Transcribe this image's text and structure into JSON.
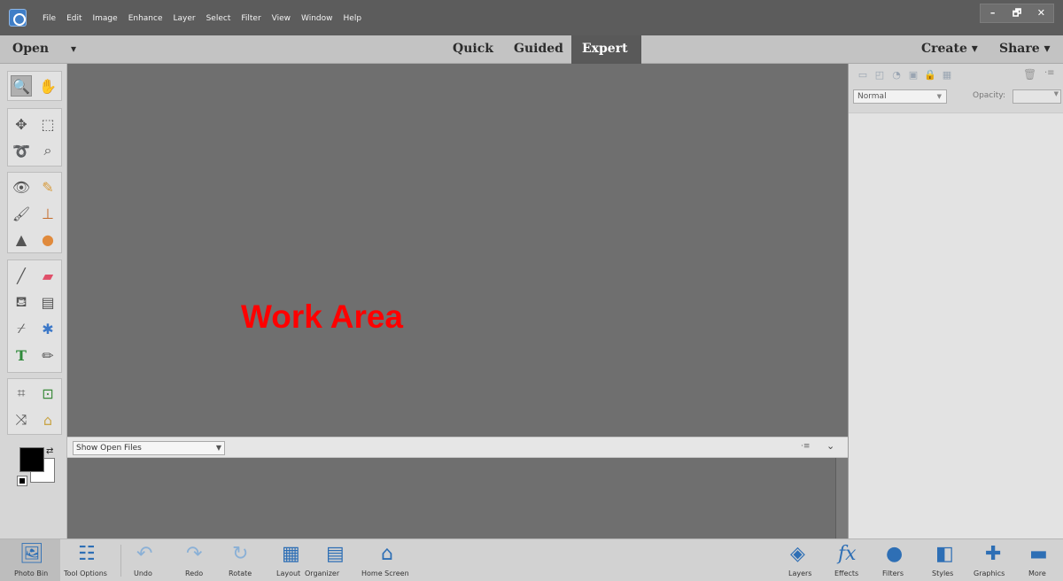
{
  "menu": [
    "File",
    "Edit",
    "Image",
    "Enhance",
    "Layer",
    "Select",
    "Filter",
    "View",
    "Window",
    "Help"
  ],
  "window_controls": {
    "minimize": "–",
    "restore": "🗗",
    "close": "✕"
  },
  "modebar": {
    "open": "Open",
    "caret": "▾",
    "tabs": [
      "Quick",
      "Guided",
      "Expert"
    ],
    "active_tab": "Expert",
    "create": "Create",
    "share": "Share"
  },
  "work_area": {
    "label": "Work Area",
    "label_color": "#ff0000"
  },
  "photo_bin": {
    "select_value": "Show Open Files"
  },
  "layers_panel": {
    "blend_mode": "Normal",
    "opacity_label": "Opacity:"
  },
  "colors": {
    "foreground": "#000000",
    "background": "#ffffff"
  },
  "taskbar": {
    "left": [
      "Photo Bin",
      "Tool Options",
      "Undo",
      "Redo",
      "Rotate",
      "Layout",
      "Organizer",
      "Home Screen"
    ],
    "right": [
      "Layers",
      "Effects",
      "Filters",
      "Styles",
      "Graphics",
      "More"
    ]
  }
}
